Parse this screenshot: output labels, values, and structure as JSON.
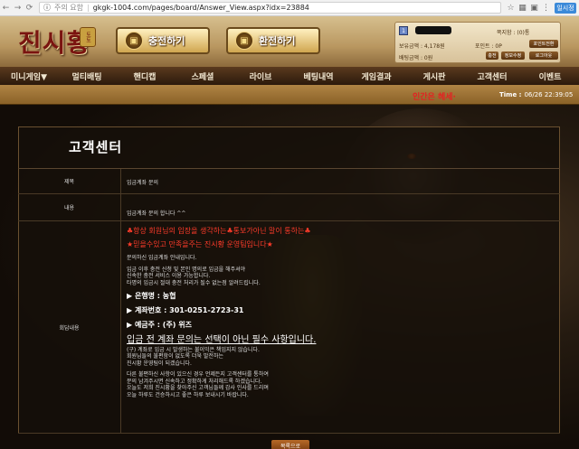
{
  "browser": {
    "security": "주의 요함",
    "url": "gkgk-1004.com/pages/board/Answer_View.aspx?idx=23884",
    "ext_label": "일시정"
  },
  "header": {
    "logo_text": "진시황",
    "logo_badge": "토토",
    "charge_label": "충전하기",
    "exchange_label": "환전하기",
    "user": {
      "level": "1",
      "friend_label": "쪽지함 : (0)통",
      "cash_label": "보유금액 : 4,178원",
      "point_label": "포인트 : 0P",
      "betting_label": "배팅금액 : 0원",
      "btn_point_convert": "포인트전환",
      "btn_charge": "충전",
      "btn_edit": "정보수정",
      "btn_logout": "로그아웃"
    }
  },
  "nav": [
    "미니게임▼",
    "멀티배팅",
    "핸디캡",
    "스페셜",
    "라이브",
    "베팅내역",
    "게임결과",
    "게시판",
    "고객센터",
    "이벤트"
  ],
  "subbar": {
    "marquee": "인간은 헤세·",
    "time_label": "Time :",
    "time_value": "06/26 22:39:05"
  },
  "panel": {
    "title": "고객센터",
    "subject_label": "제목",
    "subject_value": "입금계좌 문의",
    "content_label": "내용",
    "content_value": "입금계좌 문의 합니다 ^^",
    "answer_label": "회답내용",
    "answer": {
      "l1": "♣항상 회원님의 입장을 생각하는♣통보가아닌 말이 통하는♣",
      "l2": "★믿을수있고 만족을주는 진시황 운영팀입니다★",
      "l3": "문의하신 입금계좌 안내입니다.",
      "l4": "입금 이후 충전 신청 및 본인 명의로 입금을 해주셔야",
      "l5": "신속한 충전 서비스 이용 가능합니다.",
      "l6": "타명의 입금시 절대 충전 처리가 될수 없는점 알려드립니다.",
      "bank": "▶ 은행명 : 농협",
      "account": "▶ 계좌번호 : 301-0251-2723-31",
      "holder": "▶ 예금주 : (주) 위즈",
      "warn": "입금 전 계좌 문의는 선택이 아닌 필수 사항입니다.",
      "l7": "(구) 계좌로 입금 시 발생하는 불이익은 책임지지 않습니다.",
      "l8": "회원님들의 불편함이 없도록 더욱 발전하는",
      "l9": "진시황 운영팀이 되겠습니다.",
      "l10": "다른 불편하신 사항이 있으신 경우 언제든지 고객센터를 통하여",
      "l11": "문의 남겨주시면 신속하고 정확하게 처리해드록 하겠습니다.",
      "l12": "오늘도 저희 진시황을 찾아주신 고객님들께 감사 인사를 드리며",
      "l13": "오늘 하루도 건승하시고 좋은 하루 보내시기 바랍니다."
    },
    "list_button": "목록으로"
  }
}
